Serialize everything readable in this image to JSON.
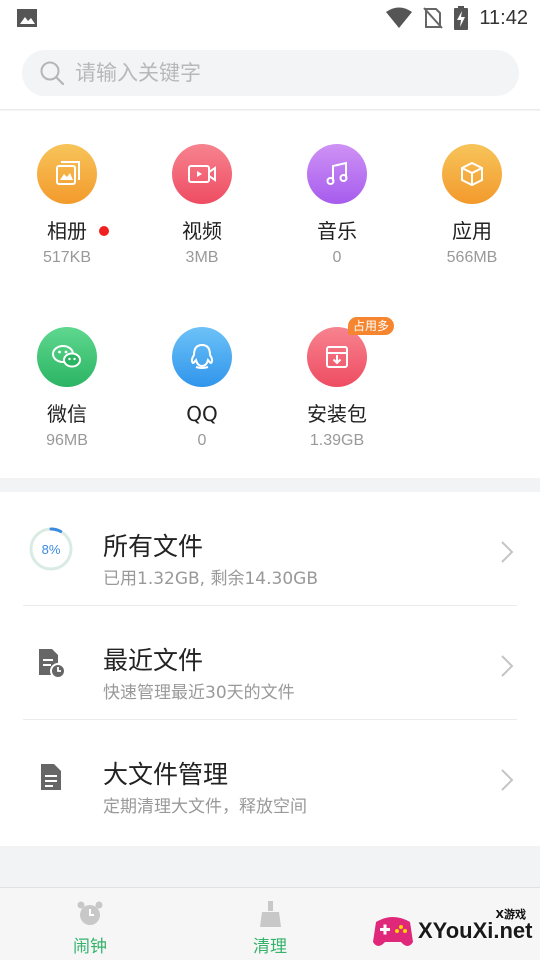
{
  "status_bar": {
    "time": "11:42"
  },
  "search": {
    "placeholder": "请输入关键字"
  },
  "categories": [
    {
      "name": "相册",
      "size": "517KB",
      "color": "#f5a623",
      "icon": "album-icon",
      "has_dot": true
    },
    {
      "name": "视频",
      "size": "3MB",
      "color": "#f0566a",
      "icon": "video-icon"
    },
    {
      "name": "音乐",
      "size": "0",
      "color": "#b56ef0",
      "icon": "music-icon"
    },
    {
      "name": "应用",
      "size": "566MB",
      "color": "#f5a623",
      "icon": "app-box-icon"
    },
    {
      "name": "微信",
      "size": "96MB",
      "color": "#34c26e",
      "icon": "wechat-icon"
    },
    {
      "name": "QQ",
      "size": "0",
      "color": "#3ea6f0",
      "icon": "qq-icon"
    },
    {
      "name": "安装包",
      "size": "1.39GB",
      "color": "#f0566a",
      "icon": "package-icon",
      "badge": "占用多"
    }
  ],
  "list": [
    {
      "title": "所有文件",
      "subtitle": "已用1.32GB, 剩余14.30GB",
      "percent_label": "8%",
      "progress": 0.08
    },
    {
      "title": "最近文件",
      "subtitle": "快速管理最近30天的文件",
      "icon": "recent-file-icon"
    },
    {
      "title": "大文件管理",
      "subtitle": "定期清理大文件，释放空间",
      "icon": "large-file-icon"
    }
  ],
  "tabs": [
    {
      "label": "闹钟",
      "icon": "alarm-clock-icon",
      "color": "#34b36a"
    },
    {
      "label": "清理",
      "icon": "broom-icon",
      "color": "#34b36a"
    }
  ],
  "watermark": {
    "text": "XYouXi.net",
    "cn": "X游戏"
  },
  "colors": {
    "accent_blue": "#3b8be0",
    "accent_green": "#34b36a"
  }
}
